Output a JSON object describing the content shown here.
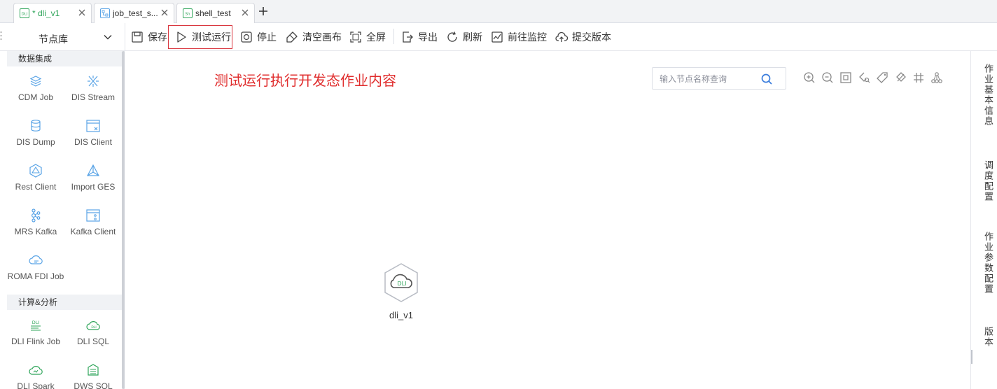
{
  "tabs": [
    {
      "badge": "DLI",
      "label": "* dli_v1",
      "color": "#2fa55a"
    },
    {
      "badge": "flow",
      "label": "job_test_s...",
      "color": "#333333"
    },
    {
      "badge": "Sh",
      "label": "shell_test",
      "color": "#333333"
    }
  ],
  "toolbar": {
    "node_library": "节点库",
    "save": "保存",
    "test_run": "测试运行",
    "stop": "停止",
    "clear_canvas": "清空画布",
    "fullscreen": "全屏",
    "export": "导出",
    "refresh": "刷新",
    "go_monitor": "前往监控",
    "submit_version": "提交版本"
  },
  "node_library": {
    "groups": [
      {
        "title": "数据集成",
        "items": [
          "CDM Job",
          "DIS Stream",
          "DIS Dump",
          "DIS Client",
          "Rest Client",
          "Import GES",
          "MRS Kafka",
          "Kafka Client",
          "ROMA FDI Job"
        ]
      },
      {
        "title": "计算&分析",
        "items": [
          "DLI Flink Job",
          "DLI SQL",
          "DLI Spark",
          "DWS SQL"
        ]
      }
    ]
  },
  "canvas": {
    "annotation": "测试运行执行开发态作业内容",
    "search_placeholder": "输入节点名称查询",
    "node_label": "dli_v1",
    "node_badge": "DLI"
  },
  "right_panel": {
    "tabs": [
      "作业基本信息",
      "调度配置",
      "作业参数配置",
      "版本"
    ]
  },
  "colors": {
    "accent": "#3b7ddd",
    "node_icon": "#5aa4e6",
    "highlight_border": "#d9363e",
    "annotation": "#e02d2d",
    "active_tab_text": "#2fa55a"
  }
}
